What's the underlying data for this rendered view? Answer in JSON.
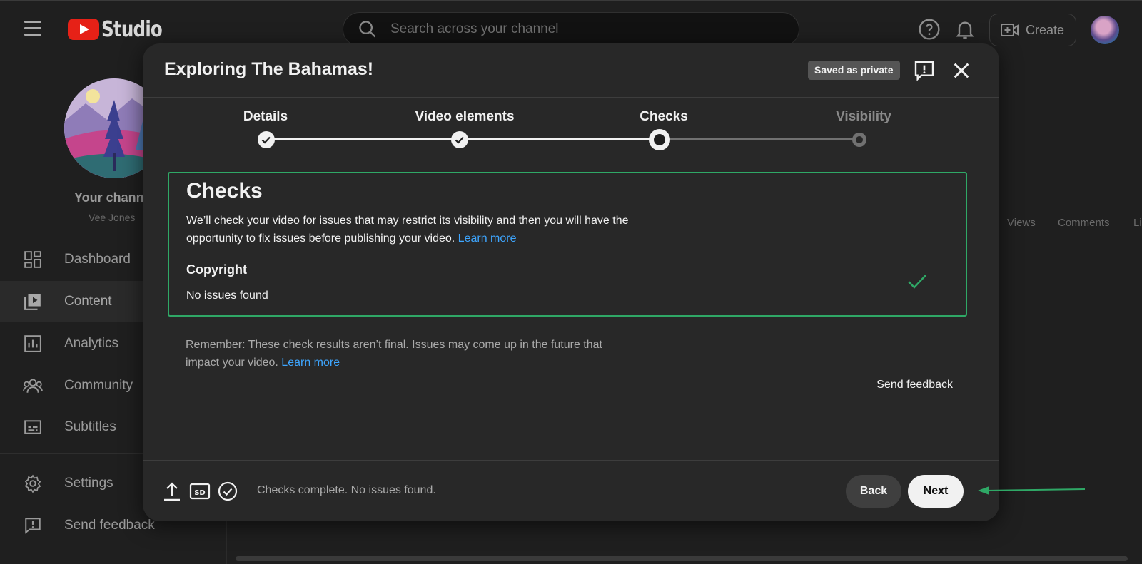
{
  "app": {
    "logo_text": "Studio"
  },
  "search": {
    "placeholder": "Search across your channel"
  },
  "topbar": {
    "create_label": "Create"
  },
  "channel": {
    "title": "Your channel",
    "name": "Vee Jones"
  },
  "sidebar": {
    "items": [
      {
        "label": "Dashboard",
        "icon": "dashboard-icon"
      },
      {
        "label": "Content",
        "icon": "content-icon",
        "active": true
      },
      {
        "label": "Analytics",
        "icon": "analytics-icon"
      },
      {
        "label": "Community",
        "icon": "community-icon"
      },
      {
        "label": "Subtitles",
        "icon": "subtitles-icon"
      }
    ],
    "bottom_items": [
      {
        "label": "Settings",
        "icon": "settings-icon"
      },
      {
        "label": "Send feedback",
        "icon": "feedback-icon"
      }
    ]
  },
  "background_table": {
    "columns": [
      "Views",
      "Comments",
      "Li"
    ]
  },
  "modal": {
    "title": "Exploring The Bahamas!",
    "saved_badge": "Saved as private",
    "steps": [
      {
        "label": "Details",
        "state": "done"
      },
      {
        "label": "Video elements",
        "state": "done"
      },
      {
        "label": "Checks",
        "state": "current"
      },
      {
        "label": "Visibility",
        "state": "pending"
      }
    ],
    "checks": {
      "title": "Checks",
      "description": "We’ll check your video for issues that may restrict its visibility and then you will have the opportunity to fix issues before publishing your video.",
      "learn_more": "Learn more",
      "copyright_title": "Copyright",
      "copyright_status": "No issues found"
    },
    "remember": {
      "text": "Remember: These check results aren’t final. Issues may come up in the future that impact your video.",
      "learn_more": "Learn more"
    },
    "send_feedback": "Send feedback",
    "footer": {
      "status": "Checks complete. No issues found.",
      "back_label": "Back",
      "next_label": "Next"
    }
  },
  "colors": {
    "accent_green": "#2fa866",
    "link_blue": "#3ea6ff",
    "youtube_red": "#e62117"
  }
}
